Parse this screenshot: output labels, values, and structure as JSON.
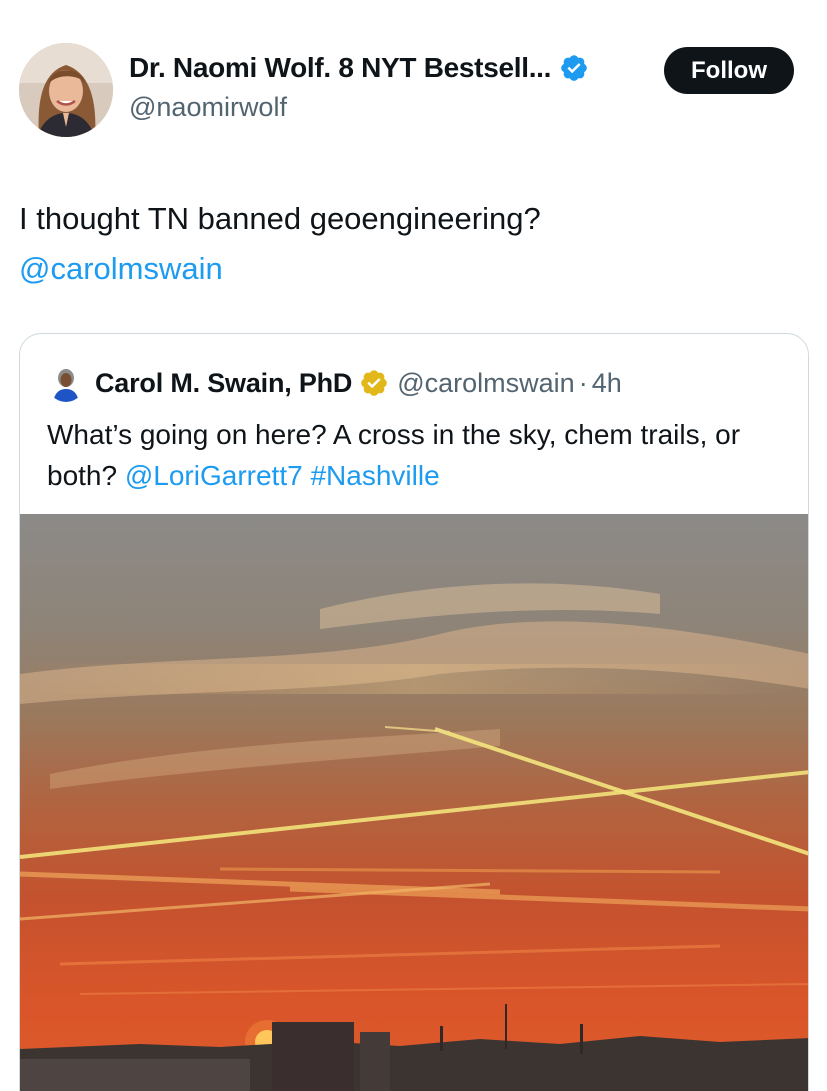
{
  "author": {
    "display_name": "Dr. Naomi Wolf. 8 NYT Bestsell...",
    "handle": "@naomirwolf",
    "avatar": "avatar-photo",
    "verified_icon": "verified-blue-badge-icon",
    "verified_color": "#1d9bf0"
  },
  "follow_button": {
    "label": "Follow"
  },
  "tweet": {
    "text": "I thought TN banned geoengineering?",
    "mention": "@carolmswain"
  },
  "quoted_tweet": {
    "display_name": "Carol M. Swain, PhD",
    "handle": "@carolmswain",
    "separator": "·",
    "time": "4h",
    "badge_icon": "verified-gold-badge-icon",
    "badge_color": "#e2b719",
    "text_before": "What’s going on here? A cross in the sky, chem trails, or both?",
    "mention": "@LoriGarrett7",
    "hashtag": "#Nashville",
    "media": "sunset-sky-with-contrails-photo"
  },
  "colors": {
    "link": "#1d9bf0",
    "text": "#0f1419",
    "secondary": "#536471",
    "border": "#cfd9de"
  }
}
